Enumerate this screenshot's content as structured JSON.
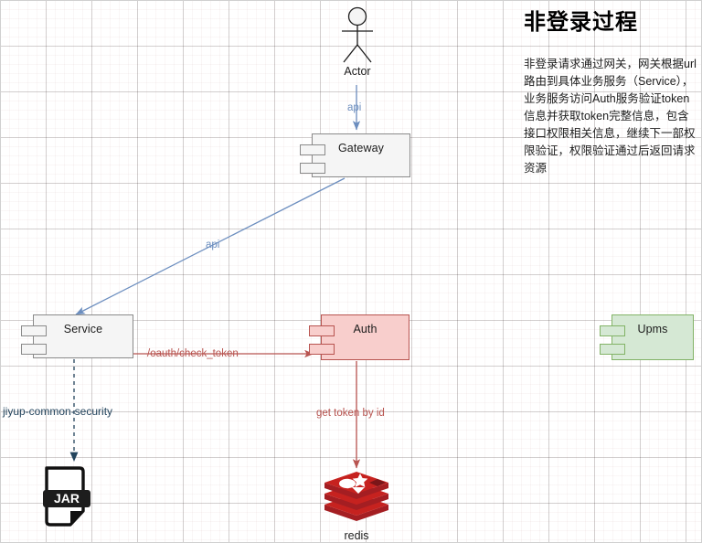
{
  "doc": {
    "title": "非登录过程",
    "description": "非登录请求通过网关，网关根据url路由到具体业务服务（Service），业务服务访问Auth服务验证token信息并获取token完整信息，包含接口权限相关信息，继续下一部权限验证，权限验证通过后返回请求资源"
  },
  "nodes": {
    "actor": {
      "label": "Actor",
      "icon": "actor-stick-figure-icon"
    },
    "gateway": {
      "label": "Gateway",
      "type": "component",
      "fill": "#f5f5f5",
      "stroke": "#8a8a8a"
    },
    "service": {
      "label": "Service",
      "type": "component",
      "fill": "#f5f5f5",
      "stroke": "#8a8a8a"
    },
    "auth": {
      "label": "Auth",
      "type": "component",
      "fill": "#f8cecc",
      "stroke": "#b85450"
    },
    "upms": {
      "label": "Upms",
      "type": "component",
      "fill": "#d5e8d4",
      "stroke": "#82b366"
    },
    "jar": {
      "label": "JAR",
      "icon": "jar-file-icon"
    },
    "redis": {
      "label": "redis",
      "icon": "redis-logo-icon",
      "color": "#c6221f"
    }
  },
  "edges": {
    "actor_to_gateway": {
      "label": "api",
      "color": "#6c8ebf",
      "style": "solid"
    },
    "gateway_to_service": {
      "label": "api",
      "color": "#6c8ebf",
      "style": "solid"
    },
    "service_to_auth": {
      "label": "/oauth/check_token",
      "color": "#b85450",
      "style": "solid"
    },
    "service_to_jar": {
      "label": "jiyup-common-security",
      "color": "#23445d",
      "style": "dashed"
    },
    "auth_to_redis": {
      "label": "get token by id",
      "color": "#b85450",
      "style": "solid"
    }
  },
  "colors": {
    "accent_blue": "#6c8ebf",
    "accent_red": "#b85450",
    "accent_green": "#82b366",
    "redis_red": "#c6221f",
    "grid": "#d0d0d0"
  }
}
